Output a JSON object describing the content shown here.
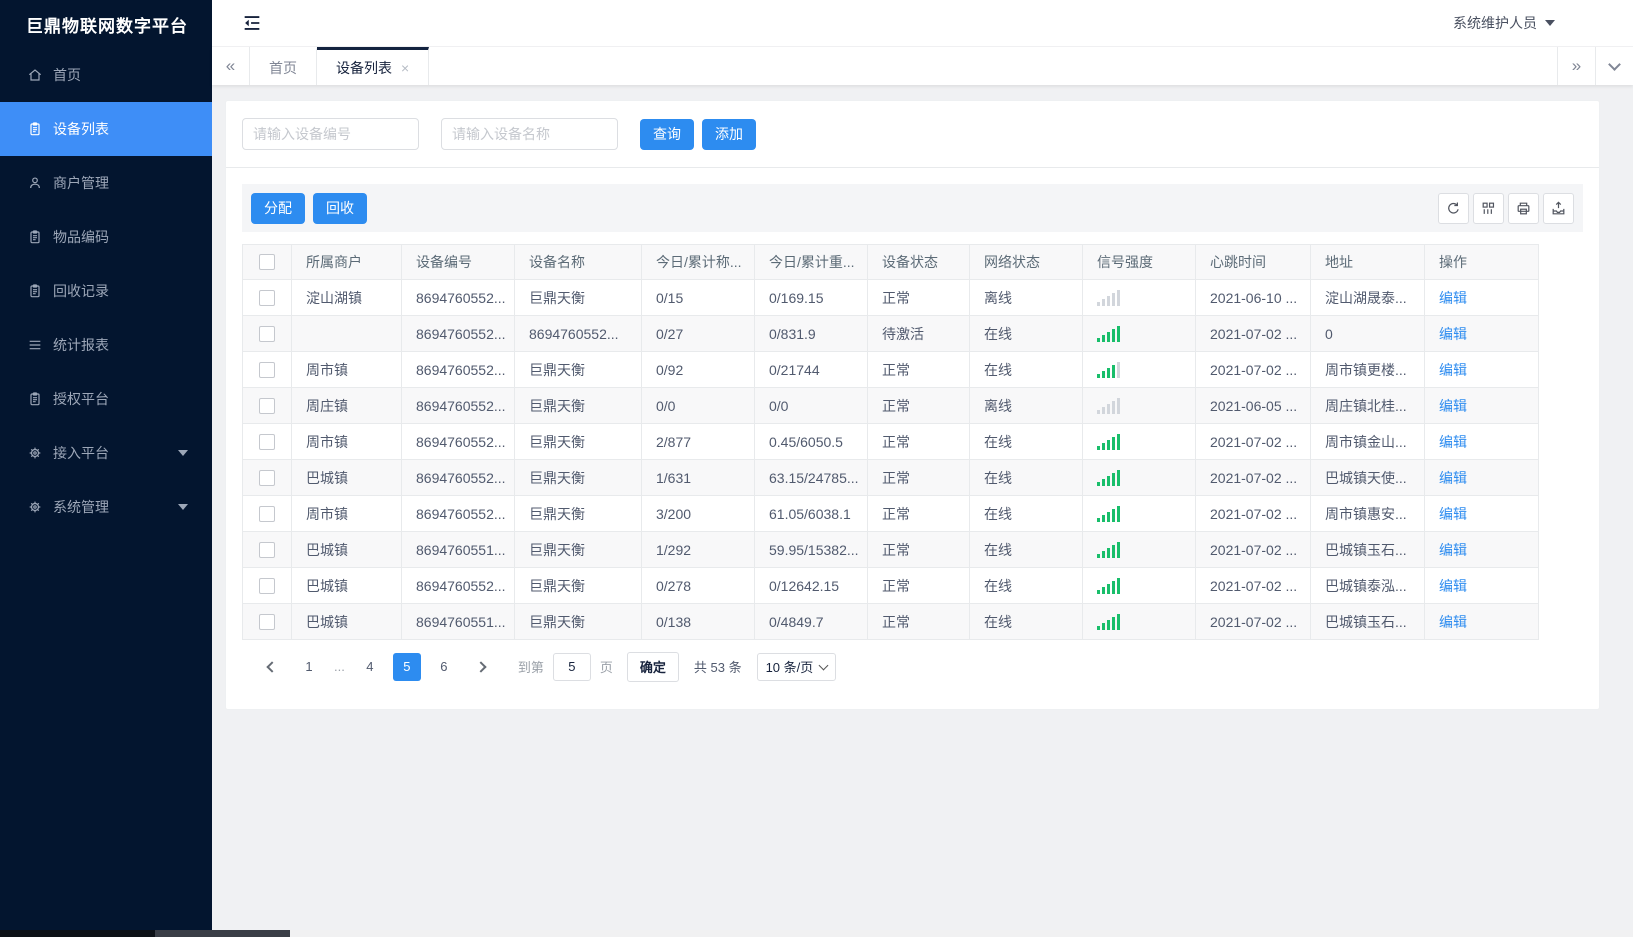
{
  "app": {
    "logo": "巨鼎物联网数字平台",
    "user_name": "系统维护人员"
  },
  "sidebar": {
    "items": [
      {
        "label": "首页",
        "icon": "home-icon",
        "active": false,
        "caret": false
      },
      {
        "label": "设备列表",
        "icon": "doc-icon",
        "active": true,
        "caret": false
      },
      {
        "label": "商户管理",
        "icon": "user-icon",
        "active": false,
        "caret": false
      },
      {
        "label": "物品编码",
        "icon": "doc-icon",
        "active": false,
        "caret": false
      },
      {
        "label": "回收记录",
        "icon": "doc-icon",
        "active": false,
        "caret": false
      },
      {
        "label": "统计报表",
        "icon": "list-icon",
        "active": false,
        "caret": false
      },
      {
        "label": "授权平台",
        "icon": "doc-icon",
        "active": false,
        "caret": false
      },
      {
        "label": "接入平台",
        "icon": "gear-icon",
        "active": false,
        "caret": true
      },
      {
        "label": "系统管理",
        "icon": "gear-icon",
        "active": false,
        "caret": true
      }
    ]
  },
  "tabs": [
    {
      "label": "首页",
      "active": false,
      "closable": false
    },
    {
      "label": "设备列表",
      "active": true,
      "closable": true
    }
  ],
  "search": {
    "device_no_placeholder": "请输入设备编号",
    "device_name_placeholder": "请输入设备名称",
    "query_label": "查询",
    "add_label": "添加"
  },
  "toolbar": {
    "assign_label": "分配",
    "recycle_label": "回收"
  },
  "table": {
    "columns": [
      "所属商户",
      "设备编号",
      "设备名称",
      "今日/累计称...",
      "今日/累计重...",
      "设备状态",
      "网络状态",
      "信号强度",
      "心跳时间",
      "地址",
      "操作"
    ],
    "edit_label": "编辑",
    "rows": [
      {
        "merchant": "淀山湖镇",
        "device_no": "8694760552...",
        "device_name": "巨鼎天衡",
        "today_count": "0/15",
        "today_weight": "0/169.15",
        "device_status": "正常",
        "network_status": "离线",
        "online": false,
        "signal": 0,
        "heartbeat": "2021-06-10 ...",
        "address": "淀山湖晟泰..."
      },
      {
        "merchant": "",
        "device_no": "8694760552...",
        "device_name": "8694760552...",
        "today_count": "0/27",
        "today_weight": "0/831.9",
        "device_status": "待激活",
        "network_status": "在线",
        "online": true,
        "signal": 5,
        "heartbeat": "2021-07-02 ...",
        "address": "0"
      },
      {
        "merchant": "周市镇",
        "device_no": "8694760552...",
        "device_name": "巨鼎天衡",
        "today_count": "0/92",
        "today_weight": "0/21744",
        "device_status": "正常",
        "network_status": "在线",
        "online": true,
        "signal": 4,
        "heartbeat": "2021-07-02 ...",
        "address": "周市镇更楼..."
      },
      {
        "merchant": "周庄镇",
        "device_no": "8694760552...",
        "device_name": "巨鼎天衡",
        "today_count": "0/0",
        "today_weight": "0/0",
        "device_status": "正常",
        "network_status": "离线",
        "online": false,
        "signal": 0,
        "heartbeat": "2021-06-05 ...",
        "address": "周庄镇北桂..."
      },
      {
        "merchant": "周市镇",
        "device_no": "8694760552...",
        "device_name": "巨鼎天衡",
        "today_count": "2/877",
        "today_weight": "0.45/6050.5",
        "device_status": "正常",
        "network_status": "在线",
        "online": true,
        "signal": 5,
        "heartbeat": "2021-07-02 ...",
        "address": "周市镇金山..."
      },
      {
        "merchant": "巴城镇",
        "device_no": "8694760552...",
        "device_name": "巨鼎天衡",
        "today_count": "1/631",
        "today_weight": "63.15/24785...",
        "device_status": "正常",
        "network_status": "在线",
        "online": true,
        "signal": 5,
        "heartbeat": "2021-07-02 ...",
        "address": "巴城镇天使..."
      },
      {
        "merchant": "周市镇",
        "device_no": "8694760552...",
        "device_name": "巨鼎天衡",
        "today_count": "3/200",
        "today_weight": "61.05/6038.1",
        "device_status": "正常",
        "network_status": "在线",
        "online": true,
        "signal": 5,
        "heartbeat": "2021-07-02 ...",
        "address": "周市镇惠安..."
      },
      {
        "merchant": "巴城镇",
        "device_no": "8694760551...",
        "device_name": "巨鼎天衡",
        "today_count": "1/292",
        "today_weight": "59.95/15382...",
        "device_status": "正常",
        "network_status": "在线",
        "online": true,
        "signal": 5,
        "heartbeat": "2021-07-02 ...",
        "address": "巴城镇玉石..."
      },
      {
        "merchant": "巴城镇",
        "device_no": "8694760552...",
        "device_name": "巨鼎天衡",
        "today_count": "0/278",
        "today_weight": "0/12642.15",
        "device_status": "正常",
        "network_status": "在线",
        "online": true,
        "signal": 5,
        "heartbeat": "2021-07-02 ...",
        "address": "巴城镇泰泓..."
      },
      {
        "merchant": "巴城镇",
        "device_no": "8694760551...",
        "device_name": "巨鼎天衡",
        "today_count": "0/138",
        "today_weight": "0/4849.7",
        "device_status": "正常",
        "network_status": "在线",
        "online": true,
        "signal": 5,
        "heartbeat": "2021-07-02 ...",
        "address": "巴城镇玉石..."
      }
    ]
  },
  "pagination": {
    "pages": [
      "1",
      "...",
      "4",
      "5",
      "6"
    ],
    "active_page": "5",
    "goto_label": "到第",
    "goto_value": "5",
    "unit_label": "页",
    "confirm_label": "确定",
    "total_label": "共 53 条",
    "page_size_label": "10 条/页"
  },
  "colors": {
    "primary": "#2d8cf0",
    "success": "#19be6b",
    "error": "#ed4014",
    "sidebar_bg": "#03152f",
    "sidebar_active": "#3e8ef7"
  }
}
